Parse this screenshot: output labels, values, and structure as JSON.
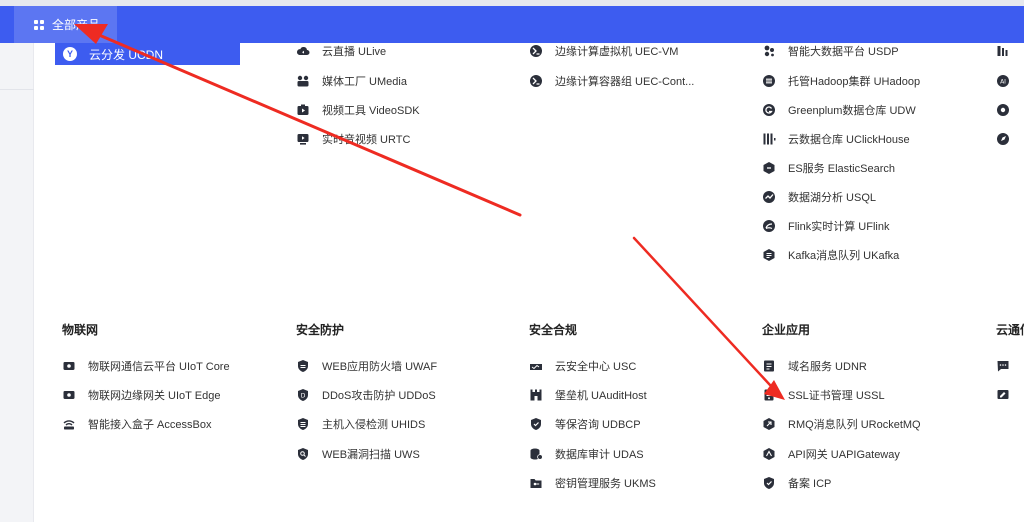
{
  "header": {
    "all_products_label": "全部产品",
    "accent_color": "#3d5cf0"
  },
  "active_tab": {
    "label": "云分发 UCDN"
  },
  "col2_top": [
    {
      "label": "云直播 ULive",
      "icon": "cloud-icon"
    },
    {
      "label": "媒体工厂 UMedia",
      "icon": "media-icon"
    },
    {
      "label": "视频工具 VideoSDK",
      "icon": "video-tool-icon"
    },
    {
      "label": "实时音视频 URTC",
      "icon": "rtc-icon"
    }
  ],
  "col3_top": [
    {
      "label": "边缘计算虚拟机 UEC-VM",
      "icon": "edge-icon"
    },
    {
      "label": "边缘计算容器组 UEC-Cont...",
      "icon": "edge-container-icon"
    }
  ],
  "col4_top": [
    {
      "label": "智能大数据平台 USDP",
      "icon": "bigdata-icon"
    },
    {
      "label": "托管Hadoop集群 UHadoop",
      "icon": "hadoop-icon"
    },
    {
      "label": "Greenplum数据仓库 UDW",
      "icon": "greenplum-icon"
    },
    {
      "label": "云数据仓库 UClickHouse",
      "icon": "clickhouse-icon"
    },
    {
      "label": "ES服务 ElasticSearch",
      "icon": "elastic-icon"
    },
    {
      "label": "数据湖分析 USQL",
      "icon": "datalake-icon"
    },
    {
      "label": "Flink实时计算 UFlink",
      "icon": "flink-icon"
    },
    {
      "label": "Kafka消息队列 UKafka",
      "icon": "kafka-icon"
    }
  ],
  "sections": {
    "iot": {
      "title": "物联网",
      "items": [
        {
          "label": "物联网通信云平台 UIoT Core",
          "icon": "iot-core-icon"
        },
        {
          "label": "物联网边缘网关 UIoT Edge",
          "icon": "iot-edge-icon"
        },
        {
          "label": "智能接入盒子 AccessBox",
          "icon": "router-icon"
        }
      ]
    },
    "security": {
      "title": "安全防护",
      "items": [
        {
          "label": "WEB应用防火墙 UWAF",
          "icon": "shield-icon"
        },
        {
          "label": "DDoS攻击防护 UDDoS",
          "icon": "ddos-shield-icon"
        },
        {
          "label": "主机入侵检测 UHIDS",
          "icon": "host-shield-icon"
        },
        {
          "label": "WEB漏洞扫描 UWS",
          "icon": "scan-shield-icon"
        }
      ]
    },
    "compliance": {
      "title": "安全合规",
      "items": [
        {
          "label": "云安全中心 USC",
          "icon": "security-center-icon"
        },
        {
          "label": "堡垒机 UAuditHost",
          "icon": "bastion-icon"
        },
        {
          "label": "等保咨询 UDBCP",
          "icon": "consult-icon"
        },
        {
          "label": "数据库审计 UDAS",
          "icon": "database-audit-icon"
        },
        {
          "label": "密钥管理服务 UKMS",
          "icon": "key-folder-icon"
        }
      ]
    },
    "enterprise": {
      "title": "企业应用",
      "items": [
        {
          "label": "域名服务 UDNR",
          "icon": "domain-icon"
        },
        {
          "label": "SSL证书管理 USSL",
          "icon": "certificate-icon"
        },
        {
          "label": "RMQ消息队列 URocketMQ",
          "icon": "rocketmq-icon"
        },
        {
          "label": "API网关 UAPIGateway",
          "icon": "api-gateway-icon"
        },
        {
          "label": "备案 ICP",
          "icon": "icp-shield-icon"
        }
      ]
    },
    "cloud_comm": {
      "title": "云通信"
    }
  },
  "annotation_color": "#ee2b22"
}
